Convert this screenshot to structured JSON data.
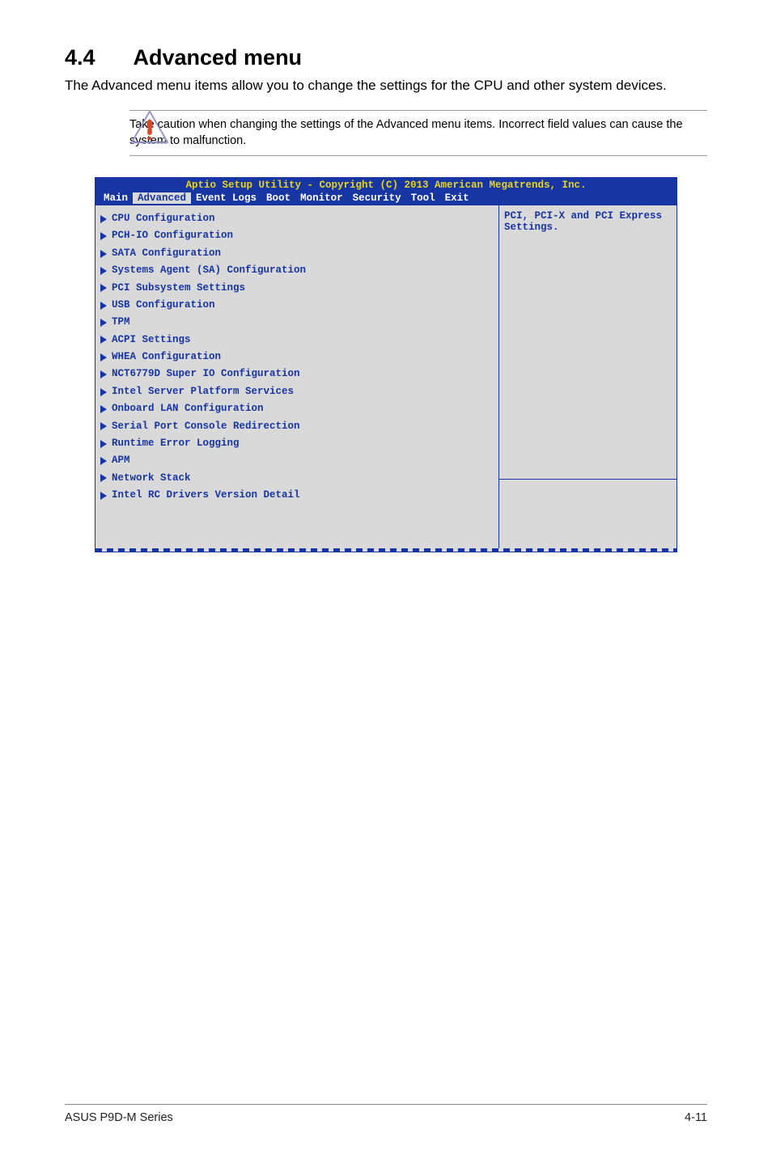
{
  "heading": {
    "number": "4.4",
    "title": "Advanced menu"
  },
  "lead": "The Advanced menu items allow you to change the settings for the CPU and other system devices.",
  "caution": "Take caution when changing the settings of the Advanced menu items. Incorrect field values can cause the system to malfunction.",
  "bios": {
    "title": "Aptio Setup Utility - Copyright (C) 2013 American Megatrends, Inc.",
    "tabs": [
      "Main",
      "Advanced",
      "Event Logs",
      "Boot",
      "Monitor",
      "Security",
      "Tool",
      "Exit"
    ],
    "selected_tab": "Advanced",
    "help": "PCI, PCI-X and PCI Express Settings.",
    "items": [
      "CPU Configuration",
      "PCH-IO Configuration",
      "SATA Configuration",
      "Systems Agent (SA) Configuration",
      "PCI Subsystem Settings",
      "USB Configuration",
      "TPM",
      "ACPI Settings",
      "WHEA Configuration",
      "NCT6779D Super IO Configuration",
      "Intel Server Platform Services",
      "Onboard LAN Configuration",
      "Serial Port Console Redirection",
      "Runtime Error Logging",
      "APM",
      "Network Stack",
      "Intel RC Drivers Version Detail"
    ]
  },
  "footer": {
    "left": "ASUS P9D-M Series",
    "right": "4-11"
  }
}
